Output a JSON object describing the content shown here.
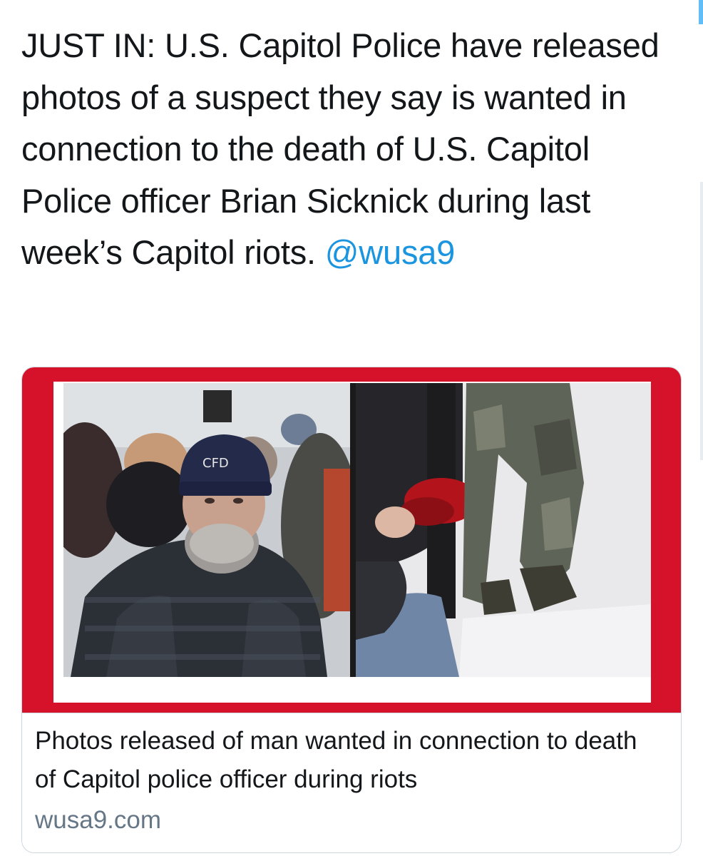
{
  "tweet": {
    "text": "JUST IN: U.S. Capitol Police have released photos of a suspect they say is wanted in connection to the death of U.S. Capitol Police officer Brian Sicknick during last week’s Capitol riots.",
    "mention": "@wusa9"
  },
  "card": {
    "title": "Photos released of man wanted in connection to death of Capitol police officer during riots",
    "domain": "wusa9.com",
    "photos": [
      {
        "label": "CFD"
      }
    ]
  },
  "colors": {
    "accent": "#1b95e0",
    "card_frame": "#d6122a",
    "text": "#14171a",
    "muted": "#657786"
  }
}
